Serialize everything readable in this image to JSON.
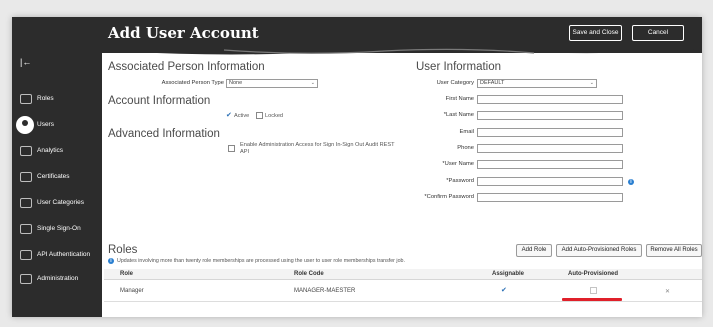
{
  "header": {
    "title": "Add User Account",
    "save_close_label": "Save and Close",
    "cancel_label": "Cancel"
  },
  "sidebar": {
    "items": [
      {
        "label": "Roles",
        "icon": "roles-icon"
      },
      {
        "label": "Users",
        "icon": "users-icon"
      },
      {
        "label": "Analytics",
        "icon": "analytics-icon"
      },
      {
        "label": "Certificates",
        "icon": "certificate-icon"
      },
      {
        "label": "User Categories",
        "icon": "categories-icon"
      },
      {
        "label": "Single Sign-On",
        "icon": "cloud-icon"
      },
      {
        "label": "API Authentication",
        "icon": "key-icon"
      },
      {
        "label": "Administration",
        "icon": "admin-icon"
      }
    ],
    "active": "Users"
  },
  "associated_person": {
    "title": "Associated Person Information",
    "type_label": "Associated Person Type",
    "type_value": "None"
  },
  "account": {
    "title": "Account Information",
    "active_label": "Active",
    "active_checked": true,
    "locked_label": "Locked",
    "locked_checked": false
  },
  "advanced": {
    "title": "Advanced Information",
    "admin_access_label": "Enable Administration Access for Sign In-Sign Out Audit REST API",
    "admin_access_checked": false
  },
  "user_info": {
    "title": "User Information",
    "category_label": "User Category",
    "category_value": "DEFAULT",
    "first_name_label": "First Name",
    "last_name_label": "*Last Name",
    "email_label": "Email",
    "phone_label": "Phone",
    "username_label": "*User Name",
    "password_label": "*Password",
    "confirm_password_label": "*Confirm Password"
  },
  "roles": {
    "title": "Roles",
    "note": "Updates involving more than twenty role memberships are processed using the user to user role memberships transfer job.",
    "add_role_label": "Add Role",
    "add_auto_label": "Add Auto-Provisioned Roles",
    "remove_all_label": "Remove All Roles",
    "columns": [
      "Role",
      "Role Code",
      "Assignable",
      "Auto-Provisioned"
    ],
    "rows": [
      {
        "role": "Manager",
        "code": "MANAGER-MAESTER",
        "assignable": true,
        "auto_provisioned": false
      }
    ],
    "highlight_color": "#e0202a"
  },
  "colors": {
    "header_bg": "#2c2c2c",
    "accent": "#2a6fb5"
  }
}
